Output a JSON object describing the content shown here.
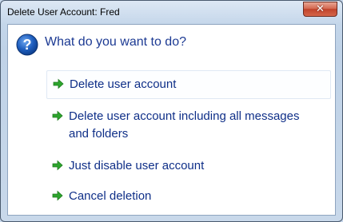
{
  "window": {
    "title": "Delete User Account: Fred",
    "close_label": "✕"
  },
  "dialog": {
    "heading": "What do you want to do?",
    "options": [
      {
        "line1": "Delete user account",
        "line2": ""
      },
      {
        "line1": "Delete user account including all messages",
        "line2": "and folders"
      },
      {
        "line1": "Just disable user account",
        "line2": ""
      },
      {
        "line1": "Cancel deletion",
        "line2": ""
      }
    ]
  },
  "colors": {
    "heading": "#1c3a93",
    "option_text": "#0f2f88",
    "arrow": "#2da52d",
    "question_icon": "#1f5fbf"
  },
  "icons": {
    "question": "question-icon",
    "option_arrow": "green-arrow-icon",
    "close": "close-icon"
  }
}
